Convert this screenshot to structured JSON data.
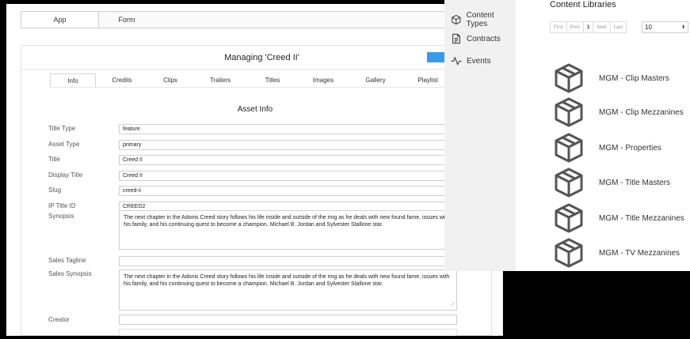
{
  "top_tabs": {
    "app": "App",
    "form": "Form"
  },
  "managing_title": "Managing 'Creed II'",
  "sub_tabs": [
    "Info",
    "Credits",
    "Clips",
    "Trailers",
    "Titles",
    "Images",
    "Gallery",
    "Playlist"
  ],
  "section_title": "Asset Info",
  "fields": {
    "title_type": {
      "label": "Title Type",
      "value": "feature"
    },
    "asset_type": {
      "label": "Asset Type",
      "value": "primary"
    },
    "title": {
      "label": "Title",
      "value": "Creed II"
    },
    "display_title": {
      "label": "Display Title",
      "value": "Creed II"
    },
    "slug": {
      "label": "Slug",
      "value": "creed-ii"
    },
    "ip_title_id": {
      "label": "IP Title ID",
      "value": "CREED2"
    },
    "synopsis": {
      "label": "Synopsis",
      "value": "The next chapter in the Adonis Creed story follows his life inside and outside of the ring as he deals with new found fame, issues with his family, and his continuing quest to become a champion. Michael B. Jordan and Sylvester Stallone star."
    },
    "sales_tagline": {
      "label": "Sales Tagline",
      "value": ""
    },
    "sales_synopsis": {
      "label": "Sales Synopsis",
      "value": "The next chapter in the Adonis Creed story follows his life inside and outside of the ring as he deals with new found fame, issues with his family, and his continuing quest to become a champion. Michael B. Jordan and Sylvester Stallone star."
    },
    "creator": {
      "label": "Creator",
      "value": ""
    }
  },
  "side_menu": {
    "content_types": "Content Types",
    "contracts": "Contracts",
    "events": "Events"
  },
  "libraries": {
    "title": "Content Libraries",
    "pager": {
      "first": "First",
      "prev": "Prev",
      "current": "1",
      "next": "Next",
      "last": "Last"
    },
    "page_size": "10",
    "items": [
      "MGM - Clip Masters",
      "MGM - Clip Mezzanines",
      "MGM - Properties",
      "MGM - Title Masters",
      "MGM - Title Mezzanines",
      "MGM - TV Mezzanines"
    ]
  },
  "colors": {
    "accent": "#3b9ae8",
    "sidebar_bg": "#f1f1f1",
    "icon": "#555555"
  }
}
